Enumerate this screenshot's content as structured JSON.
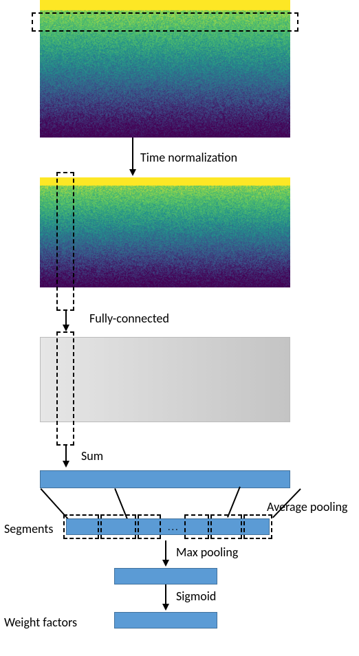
{
  "labels": {
    "time_normalization": "Time normalization",
    "fully_connected": "Fully-connected",
    "sum": "Sum",
    "average_pooling": "Average pooling",
    "segments": "Segments",
    "max_pooling": "Max pooling",
    "sigmoid": "Sigmoid",
    "weight_factors": "Weight factors",
    "ellipsis": "..."
  },
  "chart_data": {
    "type": "diagram",
    "title": "",
    "steps": [
      {
        "name": "input-spectrogram",
        "op": "input",
        "note": "horizontal dashed slice = time row"
      },
      {
        "name": "time-normalization",
        "op": "Time normalization"
      },
      {
        "name": "normalized-spectrogram",
        "op": "spectrogram",
        "note": "vertical dashed slice = frequency column"
      },
      {
        "name": "fully-connected",
        "op": "Fully-connected"
      },
      {
        "name": "feature-map",
        "op": "dense-output",
        "note": "grey block, vertical dashed column"
      },
      {
        "name": "sum",
        "op": "Sum"
      },
      {
        "name": "vector",
        "op": "1D vector bar"
      },
      {
        "name": "average-pooling",
        "op": "Average pooling over segments"
      },
      {
        "name": "segments",
        "op": "segmented vector"
      },
      {
        "name": "max-pooling",
        "op": "Max pooling"
      },
      {
        "name": "pooled",
        "op": "short vector"
      },
      {
        "name": "sigmoid",
        "op": "Sigmoid"
      },
      {
        "name": "weight-factors",
        "op": "output weight factors"
      }
    ]
  }
}
